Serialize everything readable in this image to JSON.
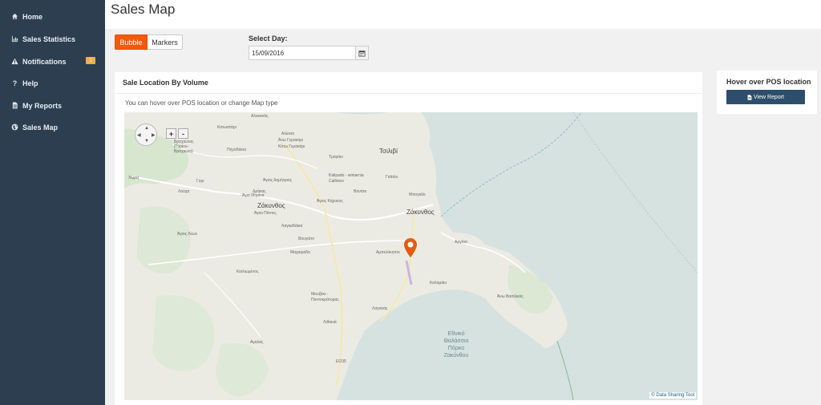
{
  "sidebar": {
    "items": [
      {
        "label": "Home",
        "icon": "home-icon"
      },
      {
        "label": "Sales Statistics",
        "icon": "bar-chart-icon"
      },
      {
        "label": "Notifications",
        "icon": "warning-icon",
        "badge": "1"
      },
      {
        "label": "Help",
        "icon": "question-icon"
      },
      {
        "label": "My Reports",
        "icon": "document-icon"
      },
      {
        "label": "Sales Map",
        "icon": "globe-icon"
      }
    ]
  },
  "header": {
    "title": "Sales Map"
  },
  "map_type": {
    "options": [
      "Bubble",
      "Markers"
    ],
    "selected": "Bubble"
  },
  "date": {
    "label": "Select Day:",
    "value": "15/09/2016"
  },
  "panel": {
    "title": "Sale Location By Volume",
    "hint": "You can hover over POS location or change Map type"
  },
  "map": {
    "zoom_in": "+",
    "zoom_out": "-",
    "attribution": "© Data Sharing Tool",
    "labels": [
      "Αλυκανάς",
      "Κατωστάρι",
      "Αλώνια",
      "Άνω Γερακάρι",
      "Κάτω Γερακάρι",
      "Βραχιώνας (Γυρίου-Βραχιώνα)",
      "Πηγαδάκια",
      "Τσιλιβί",
      "Τραγάκι",
      "Χώρα",
      "Γύρι",
      "Λούχα",
      "Άγιος Δημήτριος",
      "Kalipado - winiarnia Callinico",
      "Βανάτο",
      "Γαϊτάνι",
      "Μπογιάλι",
      "Δράκας",
      "Άγια Μαρίνα",
      "Άγιος Κήρυκος",
      "Ζάκυνθος",
      "Άγιοι Πάντες",
      "Λαγκαδάκια",
      "Άγιος Λέων",
      "Βουγιάτο",
      "Αργάσι",
      "Μαχαιράδο",
      "Αμπελόκηποι",
      "Κοιλιωμένος",
      "Καλαμάκι",
      "Μουζάκι - Παντοκράτορας",
      "Λαγανάς",
      "Άνω Βασιλικός",
      "Λιθακιά",
      "Αγαλάς",
      "ΕΟ35"
    ],
    "sea_label": "Εθνικό Θαλάσσιο Πάρκο Ζακύνθου"
  },
  "side_panel": {
    "title": "Hover over POS location",
    "button": "View Report"
  },
  "colors": {
    "sidebar": "#2c3e50",
    "accent": "#f35a0c",
    "primary_button": "#2c4e6b",
    "badge": "#f0ad4e"
  }
}
